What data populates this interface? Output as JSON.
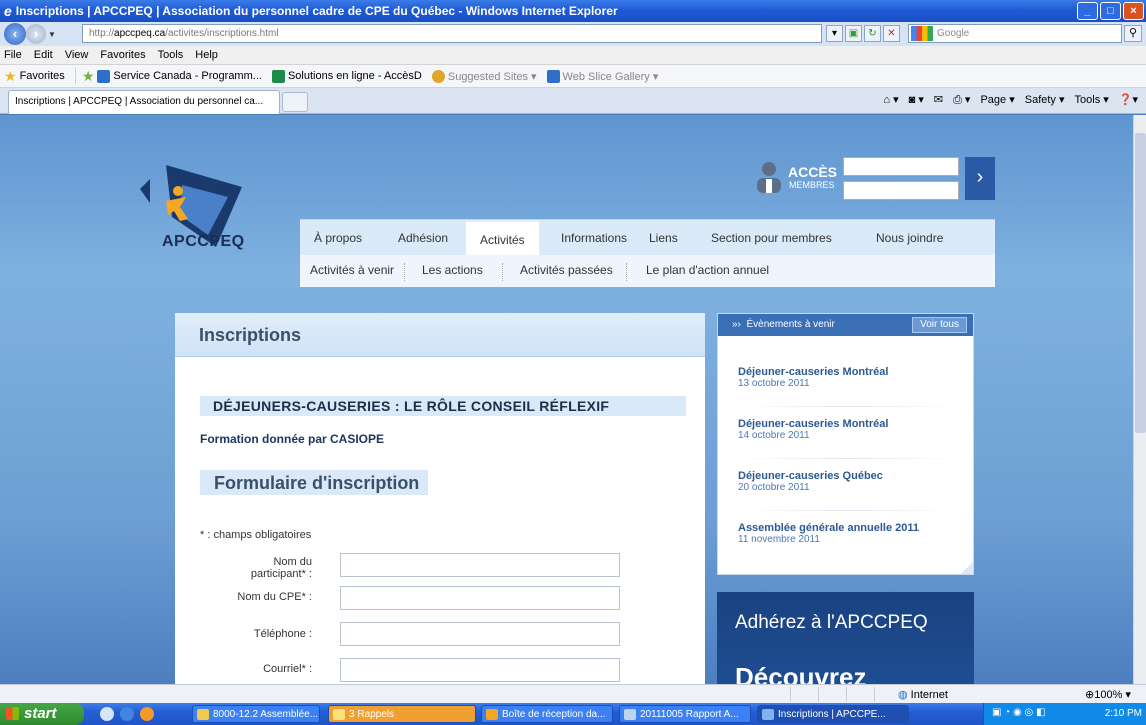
{
  "window": {
    "title": "Inscriptions | APCCPEQ | Association du personnel cadre de CPE du Québec - Windows Internet Explorer"
  },
  "address": {
    "url_prefix": "http://",
    "url_domain": "apccpeq.ca",
    "url_path": "/activites/inscriptions.html",
    "search_placeholder": "Google"
  },
  "menu": [
    "File",
    "Edit",
    "View",
    "Favorites",
    "Tools",
    "Help"
  ],
  "favorites": {
    "label": "Favorites",
    "items": [
      {
        "label": "Service Canada - Programm...",
        "muted": false
      },
      {
        "label": "Solutions en ligne - AccèsD",
        "muted": false
      },
      {
        "label": "Suggested Sites ▾",
        "muted": true
      },
      {
        "label": "Web Slice Gallery ▾",
        "muted": true
      }
    ]
  },
  "tab": {
    "label": "Inscriptions | APCCPEQ | Association du personnel ca..."
  },
  "commandbar": [
    "Page ▾",
    "Safety ▾",
    "Tools ▾"
  ],
  "site": {
    "logo_text": "APCCPEQ",
    "login": {
      "title": "ACCÈS",
      "subtitle": "MEMBRES",
      "go": "›"
    },
    "nav": [
      "À propos",
      "Adhésion",
      "Activités",
      "Informations",
      "Liens",
      "Section pour membres",
      "Nous joindre"
    ],
    "subnav": [
      "Activités à venir",
      "Les actions",
      "Activités passées",
      "Le plan d'action annuel"
    ]
  },
  "content": {
    "page_title": "Inscriptions",
    "event_title": "DÉJEUNERS-CAUSERIES : LE RÔLE CONSEIL RÉFLEXIF",
    "formation": "Formation donnée par CASIOPE",
    "form_title": "Formulaire d'inscription",
    "required_note": "* : champs obligatoires",
    "fields": [
      {
        "label_line1": "Nom du",
        "label_line2": "participant* :"
      },
      {
        "label_line1": "Nom du CPE* :",
        "label_line2": ""
      },
      {
        "label_line1": "Téléphone :",
        "label_line2": ""
      },
      {
        "label_line1": "Courriel* :",
        "label_line2": ""
      }
    ]
  },
  "sidebar": {
    "header": "Évènements à venir",
    "header_prefix": "»›",
    "see_all": "Voir tous",
    "events": [
      {
        "name": "Déjeuner-causeries Montréal",
        "date": "13 octobre 2011"
      },
      {
        "name": "Déjeuner-causeries Montréal",
        "date": "14 octobre 2011"
      },
      {
        "name": "Déjeuner-causeries Québec",
        "date": "20 octobre 2011"
      },
      {
        "name": "Assemblée générale annuelle 2011",
        "date": "11 novembre 2011"
      }
    ]
  },
  "promo": {
    "line1": "Adhérez à l'APCCPEQ",
    "line2": "Découvrez"
  },
  "status": {
    "zone": "Internet",
    "zoom": "100%"
  },
  "taskbar": {
    "start": "start",
    "tasks": [
      {
        "label": "8000-12.2 Assemblée...",
        "active": false
      },
      {
        "label": "3 Rappels",
        "active": false
      },
      {
        "label": "Boîte de réception da...",
        "active": false
      },
      {
        "label": "20111005 Rapport A...",
        "active": false
      },
      {
        "label": "Inscriptions | APCCPE...",
        "active": true
      }
    ],
    "clock": "2:10 PM"
  },
  "colors": {
    "site_blue": "#1a4280",
    "nav_bg": "#dbeaf8",
    "sidebar_header": "#3a6fb5",
    "link_blue": "#2e5993"
  }
}
